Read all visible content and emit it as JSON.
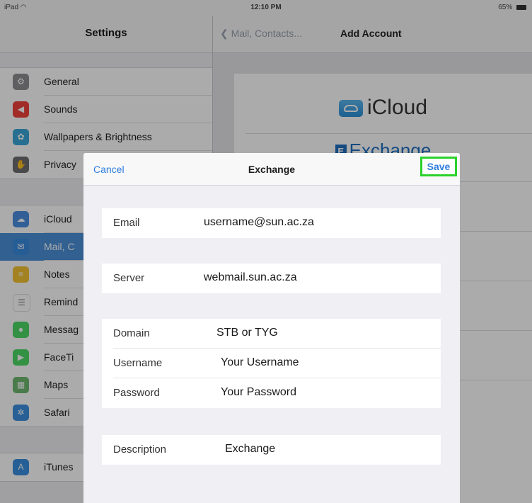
{
  "status_bar": {
    "device": "iPad",
    "wifi": "◠",
    "time": "12:10 PM",
    "battery": "65%"
  },
  "sidebar": {
    "title": "Settings",
    "groups": [
      {
        "items": [
          {
            "label": "General",
            "icon": "gear-icon",
            "color": "#8e8e93",
            "glyph": "⚙"
          },
          {
            "label": "Sounds",
            "icon": "speaker-icon",
            "color": "#f0413b",
            "glyph": "◀"
          },
          {
            "label": "Wallpapers & Brightness",
            "icon": "flower-icon",
            "color": "#3aa6d8",
            "glyph": "✿"
          },
          {
            "label": "Privacy",
            "icon": "hand-icon",
            "color": "#6d6d72",
            "glyph": "✋"
          }
        ]
      },
      {
        "items": [
          {
            "label": "iCloud",
            "icon": "cloud-icon",
            "color": "#4a8ee0",
            "glyph": "☁"
          },
          {
            "label": "Mail, C",
            "icon": "mail-icon",
            "color": "#3b8bde",
            "glyph": "✉",
            "selected": true
          },
          {
            "label": "Notes",
            "icon": "notes-icon",
            "color": "#f3c232",
            "glyph": "≡"
          },
          {
            "label": "Remind",
            "icon": "list-icon",
            "color": "#ffffff",
            "glyph": "☰"
          },
          {
            "label": "Messag",
            "icon": "message-icon",
            "color": "#4cd964",
            "glyph": "●"
          },
          {
            "label": "FaceTi",
            "icon": "camera-icon",
            "color": "#4cd964",
            "glyph": "▶"
          },
          {
            "label": "Maps",
            "icon": "map-icon",
            "color": "#6fb870",
            "glyph": "▦"
          },
          {
            "label": "Safari",
            "icon": "compass-icon",
            "color": "#3c8fe0",
            "glyph": "✲"
          }
        ]
      },
      {
        "items": [
          {
            "label": "iTunes",
            "icon": "appstore-icon",
            "color": "#3a8ee0",
            "glyph": "A"
          }
        ]
      }
    ]
  },
  "detail": {
    "back_label": "Mail, Contacts...",
    "title": "Add Account",
    "providers": [
      "iCloud",
      "Exchange"
    ]
  },
  "modal": {
    "title": "Exchange",
    "cancel_label": "Cancel",
    "save_label": "Save",
    "accent": "#2f7de1",
    "highlight": "#2bd12b",
    "groups": [
      {
        "rows": [
          {
            "label": "Email",
            "value": "username@sun.ac.za"
          }
        ]
      },
      {
        "rows": [
          {
            "label": "Server",
            "value": "webmail.sun.ac.za"
          }
        ]
      },
      {
        "rows": [
          {
            "label": "Domain",
            "value": "STB or TYG"
          },
          {
            "label": "Username",
            "value": "Your Username"
          },
          {
            "label": "Password",
            "value": "Your Password"
          }
        ]
      },
      {
        "rows": [
          {
            "label": "Description",
            "value": "Exchange"
          }
        ]
      }
    ]
  }
}
